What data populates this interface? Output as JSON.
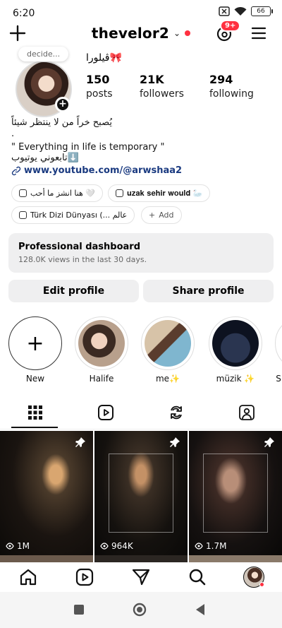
{
  "status_bar": {
    "time": "6:20",
    "battery": "66"
  },
  "header": {
    "username": "thevelor2",
    "notifications_badge": "9+"
  },
  "profile": {
    "note": "decide...",
    "full_name": "ڤيلورا🎀",
    "stats": [
      {
        "value": "150",
        "label": "posts"
      },
      {
        "value": "21K",
        "label": "followers"
      },
      {
        "value": "294",
        "label": "following"
      }
    ],
    "bio_lines": [
      "يُصبح خراً من لا ينتظر شيئاً",
      ".",
      "\" Everything in life is temporary \"",
      "تابعوني يوتيوب⬇️"
    ],
    "link": "www.youtube.com/@arwshaa2"
  },
  "highlight_pills": [
    {
      "label": "هنا انشز ما أحب 🤍"
    },
    {
      "label": "𝐮𝐳𝐚𝐤 𝐬𝐞𝐡𝐢𝐫 𝐰𝐨𝐮𝐥𝐝 🦢"
    },
    {
      "label": "Türk Dizi Dünyası (... عالم"
    },
    {
      "label": "Add"
    }
  ],
  "dashboard": {
    "title": "Professional dashboard",
    "subtitle": "128.0K views in the last 30 days."
  },
  "buttons": {
    "edit": "Edit profile",
    "share": "Share profile"
  },
  "stories": [
    {
      "label": "New"
    },
    {
      "label": "Halife"
    },
    {
      "label": "me✨"
    },
    {
      "label": "müzik ✨"
    },
    {
      "label": "S"
    }
  ],
  "posts": [
    {
      "views": "1M"
    },
    {
      "views": "964K"
    },
    {
      "views": "1.7M"
    }
  ],
  "colors": {
    "accent_red": "#ff3040",
    "link_blue": "#1a3a80",
    "button_bg": "#efeff0"
  }
}
